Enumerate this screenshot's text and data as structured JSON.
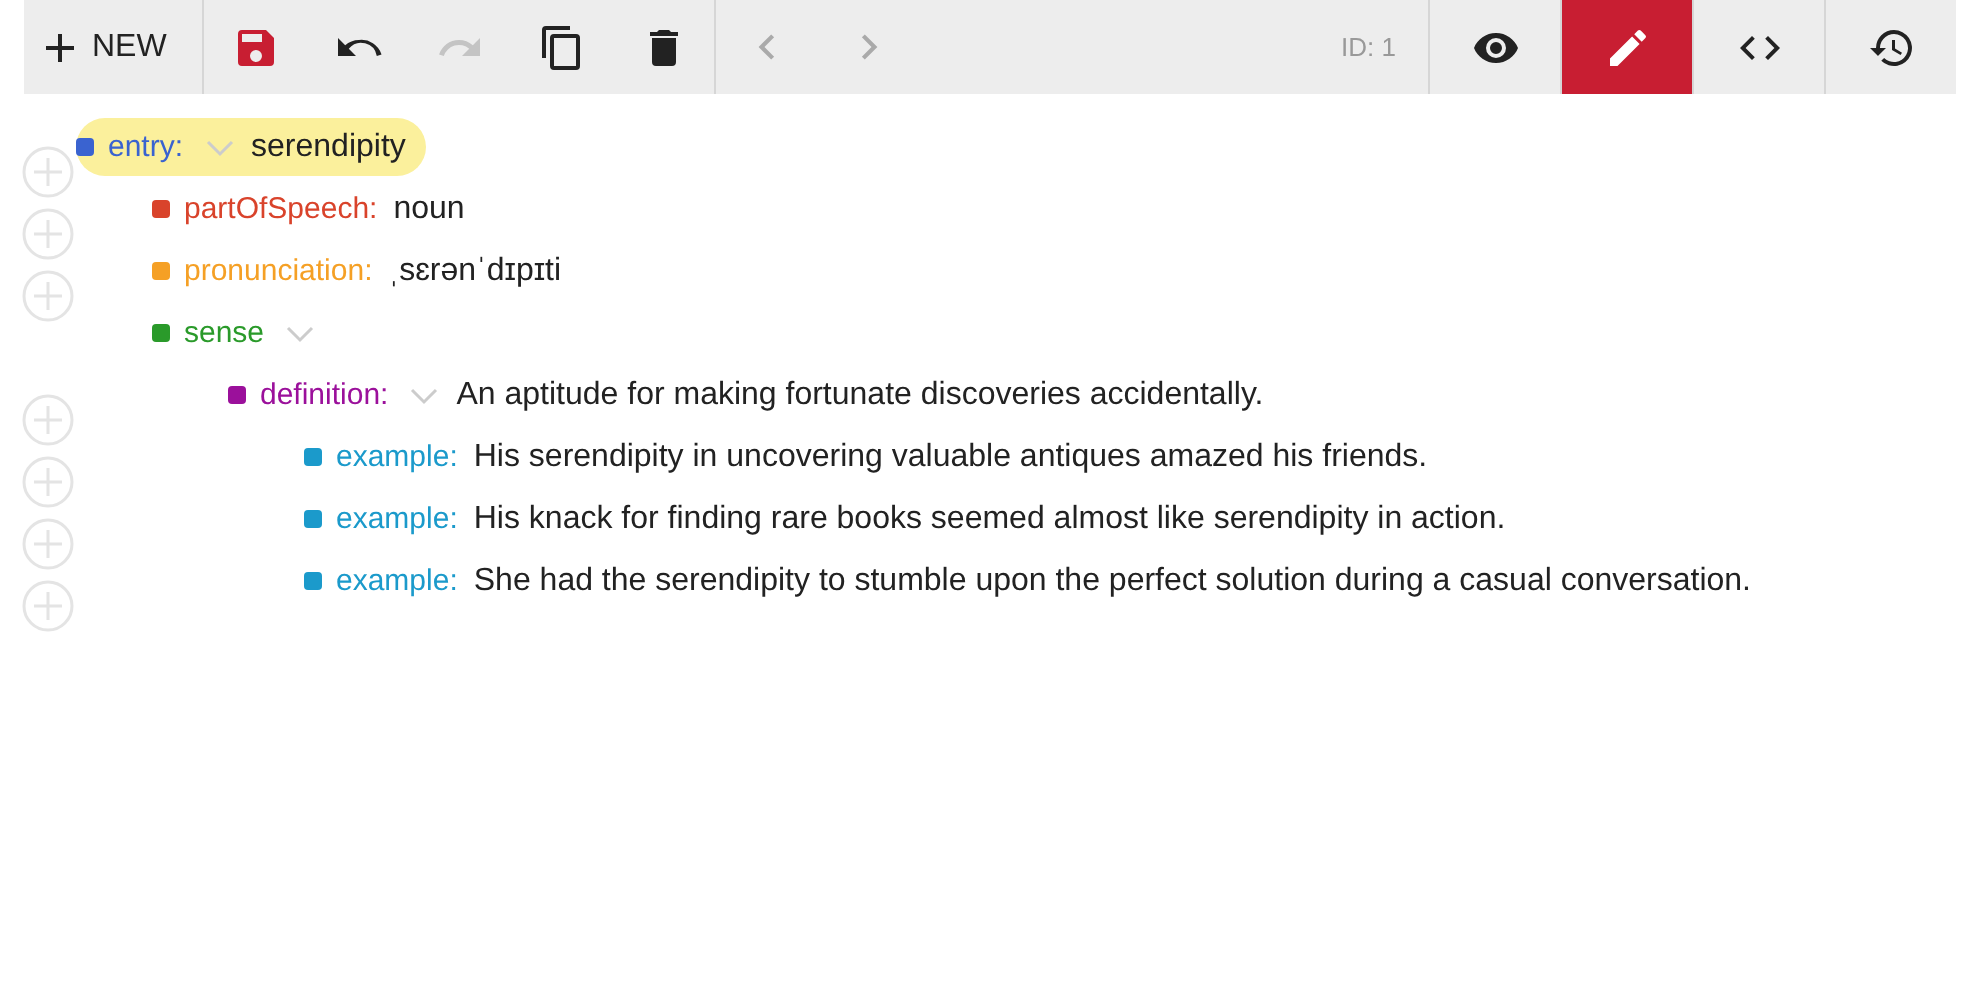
{
  "toolbar": {
    "new_label": "NEW",
    "actions": [
      {
        "kind": "save",
        "disabled": false
      },
      {
        "kind": "undo",
        "disabled": false
      },
      {
        "kind": "redo",
        "disabled": true
      },
      {
        "kind": "copy",
        "disabled": false
      },
      {
        "kind": "delete",
        "disabled": false
      }
    ],
    "nav": [
      {
        "kind": "prev",
        "disabled": true
      },
      {
        "kind": "next",
        "disabled": true
      }
    ],
    "id_label": "ID: 1",
    "modes": [
      {
        "kind": "view",
        "selected": false
      },
      {
        "kind": "edit",
        "selected": true
      },
      {
        "kind": "code",
        "selected": false
      },
      {
        "kind": "history",
        "selected": false
      }
    ]
  },
  "tree": [
    {
      "label": "entry:",
      "value": "serendipity",
      "color": "#3a63d0",
      "chevron": true,
      "highlighted": true,
      "add_button": true,
      "children": [
        {
          "label": "partOfSpeech:",
          "value": "noun",
          "color": "#d9432b",
          "chevron": false,
          "highlighted": false,
          "add_button": true
        },
        {
          "label": "pronunciation:",
          "value": "ˌsɛrənˈdɪpɪti",
          "color": "#f5a025",
          "chevron": false,
          "highlighted": false,
          "add_button": true
        },
        {
          "label": "sense",
          "color": "#2a9a2a",
          "chevron": true,
          "highlighted": false,
          "add_button": false,
          "children": [
            {
              "label": "definition:",
              "value": "An aptitude for making fortunate discoveries accidentally.",
              "color": "#9b109b",
              "chevron": true,
              "highlighted": false,
              "add_button": true,
              "children": [
                {
                  "label": "example:",
                  "value": "His serendipity in uncovering valuable antiques amazed his friends.",
                  "color": "#1b9acb",
                  "chevron": false,
                  "highlighted": false,
                  "add_button": true
                },
                {
                  "label": "example:",
                  "value": "His knack for finding rare books seemed almost like serendipity in action.",
                  "color": "#1b9acb",
                  "chevron": false,
                  "highlighted": false,
                  "add_button": true
                },
                {
                  "label": "example:",
                  "value": "She had the serendipity to stumble upon the perfect solution during a casual conversation.",
                  "color": "#1b9acb",
                  "chevron": false,
                  "highlighted": false,
                  "add_button": true
                }
              ]
            }
          ]
        }
      ]
    }
  ]
}
